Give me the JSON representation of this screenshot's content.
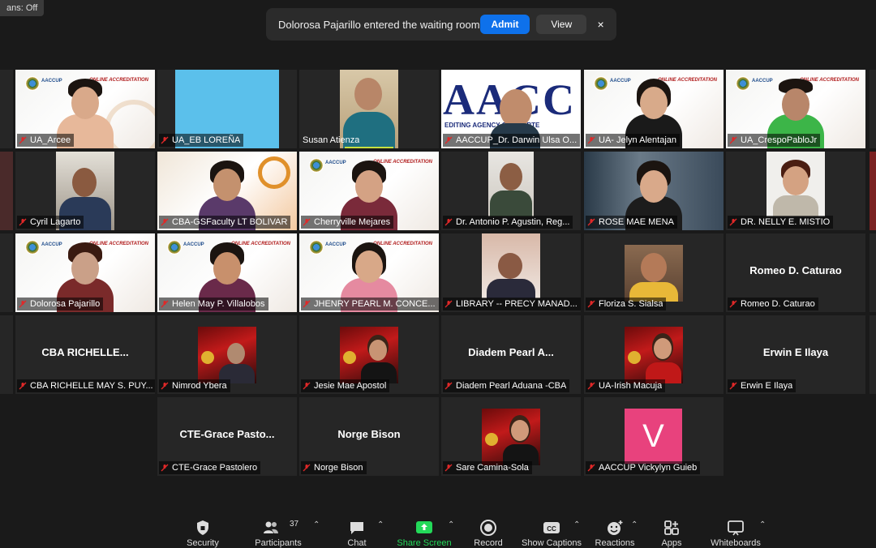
{
  "captions_status": "ans: Off",
  "notification": {
    "message": "Dolorosa Pajarillo entered the waiting room",
    "admit_label": "Admit",
    "view_label": "View",
    "close_label": "×"
  },
  "participants": [
    {
      "name": "UA_Arcee"
    },
    {
      "name": "UA_EB LOREÑA"
    },
    {
      "name": "Susan Atienza"
    },
    {
      "name": "AACCUP_Dr. Darwin Ulsa O..."
    },
    {
      "name": "UA- Jelyn Alentajan"
    },
    {
      "name": "UA_CrespoPabloJr"
    },
    {
      "name": "Cyril Lagarto"
    },
    {
      "name": "CBA-GSFaculty LT BOLIVAR"
    },
    {
      "name": "Cherryville Mejares"
    },
    {
      "name": "Dr. Antonio P. Agustin, Reg..."
    },
    {
      "name": "ROSE MAE MENA"
    },
    {
      "name": "DR. NELLY E. MISTIO"
    },
    {
      "name": "Dolorosa Pajarillo"
    },
    {
      "name": "Helen May P. Villalobos"
    },
    {
      "name": "JHENRY PEARL M. CONCE..."
    },
    {
      "name": "LIBRARY -- PRECY MANAD..."
    },
    {
      "name": "Floriza S. Sialsa"
    },
    {
      "name": "Romeo D. Caturao",
      "display": "Romeo D. Caturao"
    },
    {
      "name": "CBA RICHELLE MAY S. PUY...",
      "display": "CBA  RICHELLE..."
    },
    {
      "name": "Nimrod Ybera"
    },
    {
      "name": "Jesie Mae Apostol"
    },
    {
      "name": "Diadem Pearl Aduana -CBA",
      "display": "Diadem  Pearl  A..."
    },
    {
      "name": "UA-Irish Macuja"
    },
    {
      "name": "Erwin E Ilaya",
      "display": "Erwin E Ilaya"
    },
    {
      "name": "CTE-Grace Pastolero",
      "display": "CTE-Grace  Pasto..."
    },
    {
      "name": "Norge Bison",
      "display": "Norge Bison"
    },
    {
      "name": "Sare Camina-Sola"
    },
    {
      "name": "AACCUP Vickylyn Guieb",
      "avatar_letter": "V"
    }
  ],
  "overlay_text": {
    "aaccup_logo": "AACCUP",
    "accreditation": "ONLINE ACCREDITATION",
    "banner_letters": "AACC",
    "banner_sub": "EDITING AGENCY OF CHARTE"
  },
  "toolbar": {
    "security": "Security",
    "participants": "Participants",
    "participants_count": "37",
    "chat": "Chat",
    "share_screen": "Share Screen",
    "record": "Record",
    "show_captions": "Show Captions",
    "reactions": "Reactions",
    "apps": "Apps",
    "whiteboards": "Whiteboards"
  },
  "colors": {
    "admit_blue": "#0e71eb",
    "active_speaker": "#c7e040",
    "share_green": "#23d959",
    "muted_red": "#e02828",
    "avatar_pink": "#e8427d",
    "sky_blue": "#5bc0eb"
  }
}
